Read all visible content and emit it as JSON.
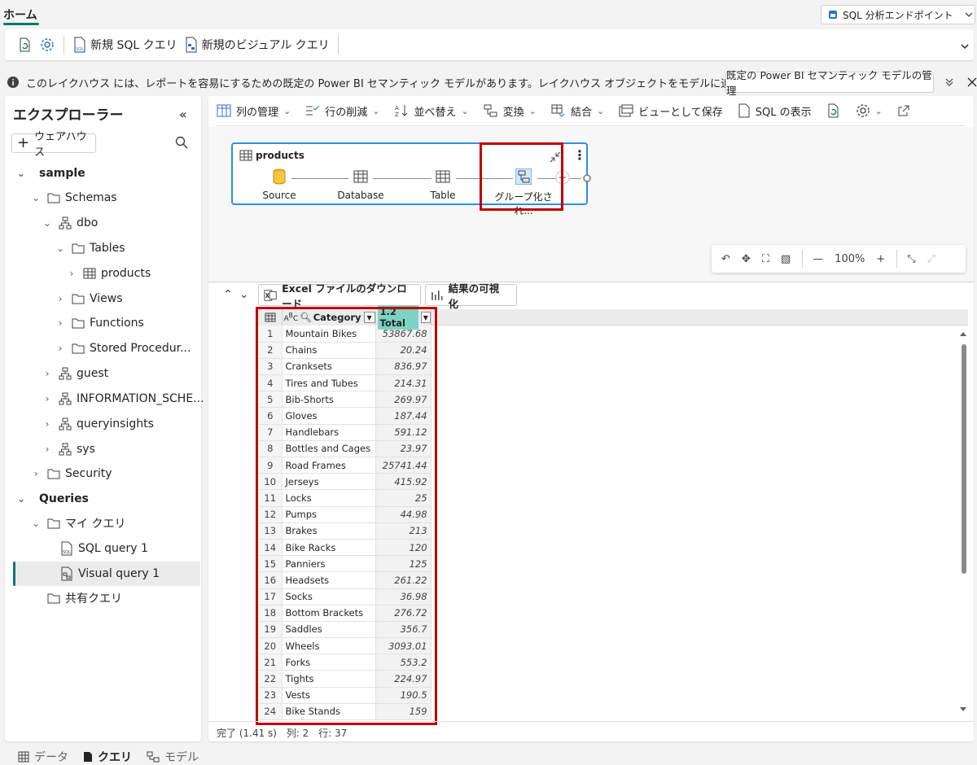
{
  "tabbar": {
    "home_tab": "ホーム",
    "endpoint_select": "SQL 分析エンドポイント"
  },
  "ribbon": {
    "new_sql_query": "新規 SQL クエリ",
    "new_visual_query": "新規のビジュアル クエリ"
  },
  "infobar": {
    "message": "このレイクハウス には、レポートを容易にするための既定の Power BI セマンティック モデルがあります。レイクハウス オブジェクトをモデルに追加するには...",
    "button": "既定の Power BI セマンティック モデルの管理"
  },
  "explorer": {
    "title": "エクスプローラー",
    "add_warehouse": "ウェアハウス",
    "tree": {
      "sample": "sample",
      "schemas": "Schemas",
      "dbo": "dbo",
      "tables": "Tables",
      "products": "products",
      "views": "Views",
      "functions": "Functions",
      "stored_procedures": "Stored Procedur...",
      "guest": "guest",
      "information_schema": "INFORMATION_SCHE...",
      "queryinsights": "queryinsights",
      "sys": "sys",
      "security": "Security",
      "queries": "Queries",
      "my_queries": "マイ クエリ",
      "sql_query_1": "SQL query 1",
      "visual_query_1": "Visual query 1",
      "shared_queries": "共有クエリ"
    }
  },
  "vq_toolbar": {
    "manage_columns": "列の管理",
    "reduce_rows": "行の削減",
    "sort": "並べ替え",
    "transform": "変換",
    "combine": "結合",
    "save_as_view": "ビューとして保存",
    "show_sql": "SQL の表示"
  },
  "diagram": {
    "card_title": "products",
    "steps": [
      "Source",
      "Database",
      "Table",
      "グループ化され..."
    ]
  },
  "zoom": {
    "level": "100%"
  },
  "results": {
    "download_excel": "Excel ファイルのダウンロード",
    "visualize": "結果の可視化",
    "columns": {
      "category": "Category",
      "total": "1.2 Total"
    },
    "rows": [
      [
        "1",
        "Mountain Bikes",
        "53867.68"
      ],
      [
        "2",
        "Chains",
        "20.24"
      ],
      [
        "3",
        "Cranksets",
        "836.97"
      ],
      [
        "4",
        "Tires and Tubes",
        "214.31"
      ],
      [
        "5",
        "Bib-Shorts",
        "269.97"
      ],
      [
        "6",
        "Gloves",
        "187.44"
      ],
      [
        "7",
        "Handlebars",
        "591.12"
      ],
      [
        "8",
        "Bottles and Cages",
        "23.97"
      ],
      [
        "9",
        "Road Frames",
        "25741.44"
      ],
      [
        "10",
        "Jerseys",
        "415.92"
      ],
      [
        "11",
        "Locks",
        "25"
      ],
      [
        "12",
        "Pumps",
        "44.98"
      ],
      [
        "13",
        "Brakes",
        "213"
      ],
      [
        "14",
        "Bike Racks",
        "120"
      ],
      [
        "15",
        "Panniers",
        "125"
      ],
      [
        "16",
        "Headsets",
        "261.22"
      ],
      [
        "17",
        "Socks",
        "36.98"
      ],
      [
        "18",
        "Bottom Brackets",
        "276.72"
      ],
      [
        "19",
        "Saddles",
        "356.7"
      ],
      [
        "20",
        "Wheels",
        "3093.01"
      ],
      [
        "21",
        "Forks",
        "553.2"
      ],
      [
        "22",
        "Tights",
        "224.97"
      ],
      [
        "23",
        "Vests",
        "190.5"
      ],
      [
        "24",
        "Bike Stands",
        "159"
      ]
    ]
  },
  "status": {
    "done": "完了 (1.41 s)",
    "cols": "列: 2",
    "rows": "行: 37"
  },
  "bottom_tabs": {
    "data": "データ",
    "query": "クエリ",
    "model": "モデル"
  },
  "colors": {
    "accent": "#117865",
    "highlight": "#c00000",
    "card_border": "#2f8ee5"
  }
}
